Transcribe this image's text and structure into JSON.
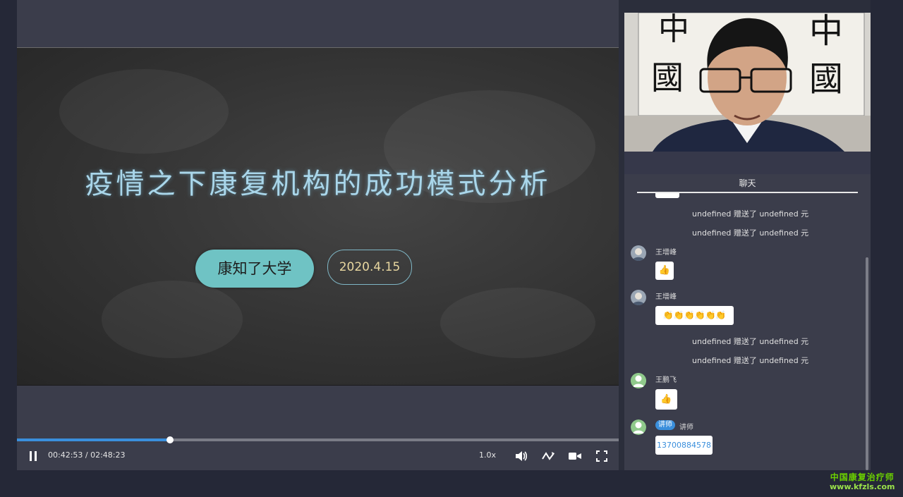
{
  "slide": {
    "title": "疫情之下康复机构的成功模式分析",
    "org": "康知了大学",
    "date": "2020.4.15"
  },
  "player": {
    "progress_fraction": 0.254,
    "time_display": "00:42:53 / 02:48:23",
    "speed": "1.0x",
    "icons": [
      "pause-icon",
      "volume-icon",
      "line-switch-icon",
      "camera-icon",
      "fullscreen-icon"
    ]
  },
  "chat": {
    "title": "聊天",
    "messages": [
      {
        "type": "system",
        "text": "undefined 赠送了 undefined 元"
      },
      {
        "type": "system",
        "text": "undefined 赠送了 undefined 元"
      },
      {
        "type": "user",
        "name": "王增峰",
        "content": "👍"
      },
      {
        "type": "user",
        "name": "王增峰",
        "content": "👏👏👏👏👏👏"
      },
      {
        "type": "system",
        "text": "undefined 赠送了 undefined 元"
      },
      {
        "type": "system",
        "text": "undefined 赠送了 undefined 元"
      },
      {
        "type": "user",
        "name": "王鹏飞",
        "content": "👍"
      },
      {
        "type": "teacher",
        "badge": "讲师",
        "name": "讲师",
        "content": "13700884578"
      }
    ]
  },
  "watermark": {
    "line1": "中国康复治疗师",
    "line2": "www.kfzls.com"
  },
  "colors": {
    "accent": "#3a8fdc",
    "slide_title": "#a9d6ea",
    "pill": "#6fc3c4",
    "watermark": "#6bd000"
  }
}
